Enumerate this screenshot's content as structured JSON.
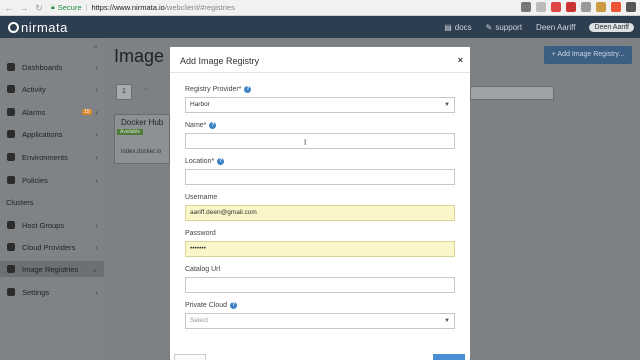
{
  "browser": {
    "secure_label": "Secure",
    "url_host": "https://www.nirmata.io",
    "url_path": "/webclient/#registries"
  },
  "header": {
    "logo_text": "nirmata",
    "docs_label": "docs",
    "support_label": "support",
    "user_name": "Deen Aariff",
    "user_chip": "Deen Aariff"
  },
  "sidebar": {
    "items": [
      {
        "label": "Dashboards"
      },
      {
        "label": "Activity"
      },
      {
        "label": "Alarms",
        "badge": "15"
      },
      {
        "label": "Applications"
      },
      {
        "label": "Environments"
      },
      {
        "label": "Policies"
      }
    ],
    "section_label": "Clusters",
    "items2": [
      {
        "label": "Host Groups"
      },
      {
        "label": "Cloud Providers"
      },
      {
        "label": "Image Registries"
      },
      {
        "label": "Settings"
      }
    ]
  },
  "background_page": {
    "title": "Image",
    "add_button": "+ Add Image Registry...",
    "page_number": "1",
    "card_title": "Docker Hub",
    "card_tag": "Available",
    "card_url": "index.docker.io"
  },
  "modal": {
    "title": "Add Image Registry",
    "close": "×",
    "fields": {
      "provider_label": "Registry Provider*",
      "provider_value": "Harbor",
      "name_label": "Name*",
      "name_value": "",
      "location_label": "Location*",
      "location_value": "",
      "username_label": "Username",
      "username_value": "aariff.deen@gmail.com",
      "password_label": "Password",
      "password_value": "•••••••",
      "catalog_label": "Catalog Url",
      "catalog_value": "",
      "private_cloud_label": "Private Cloud",
      "private_cloud_placeholder": "Select"
    }
  },
  "colors": {
    "header_bg": "#2d3e50",
    "accent": "#3a82c4",
    "autofill": "#faf6c8"
  }
}
